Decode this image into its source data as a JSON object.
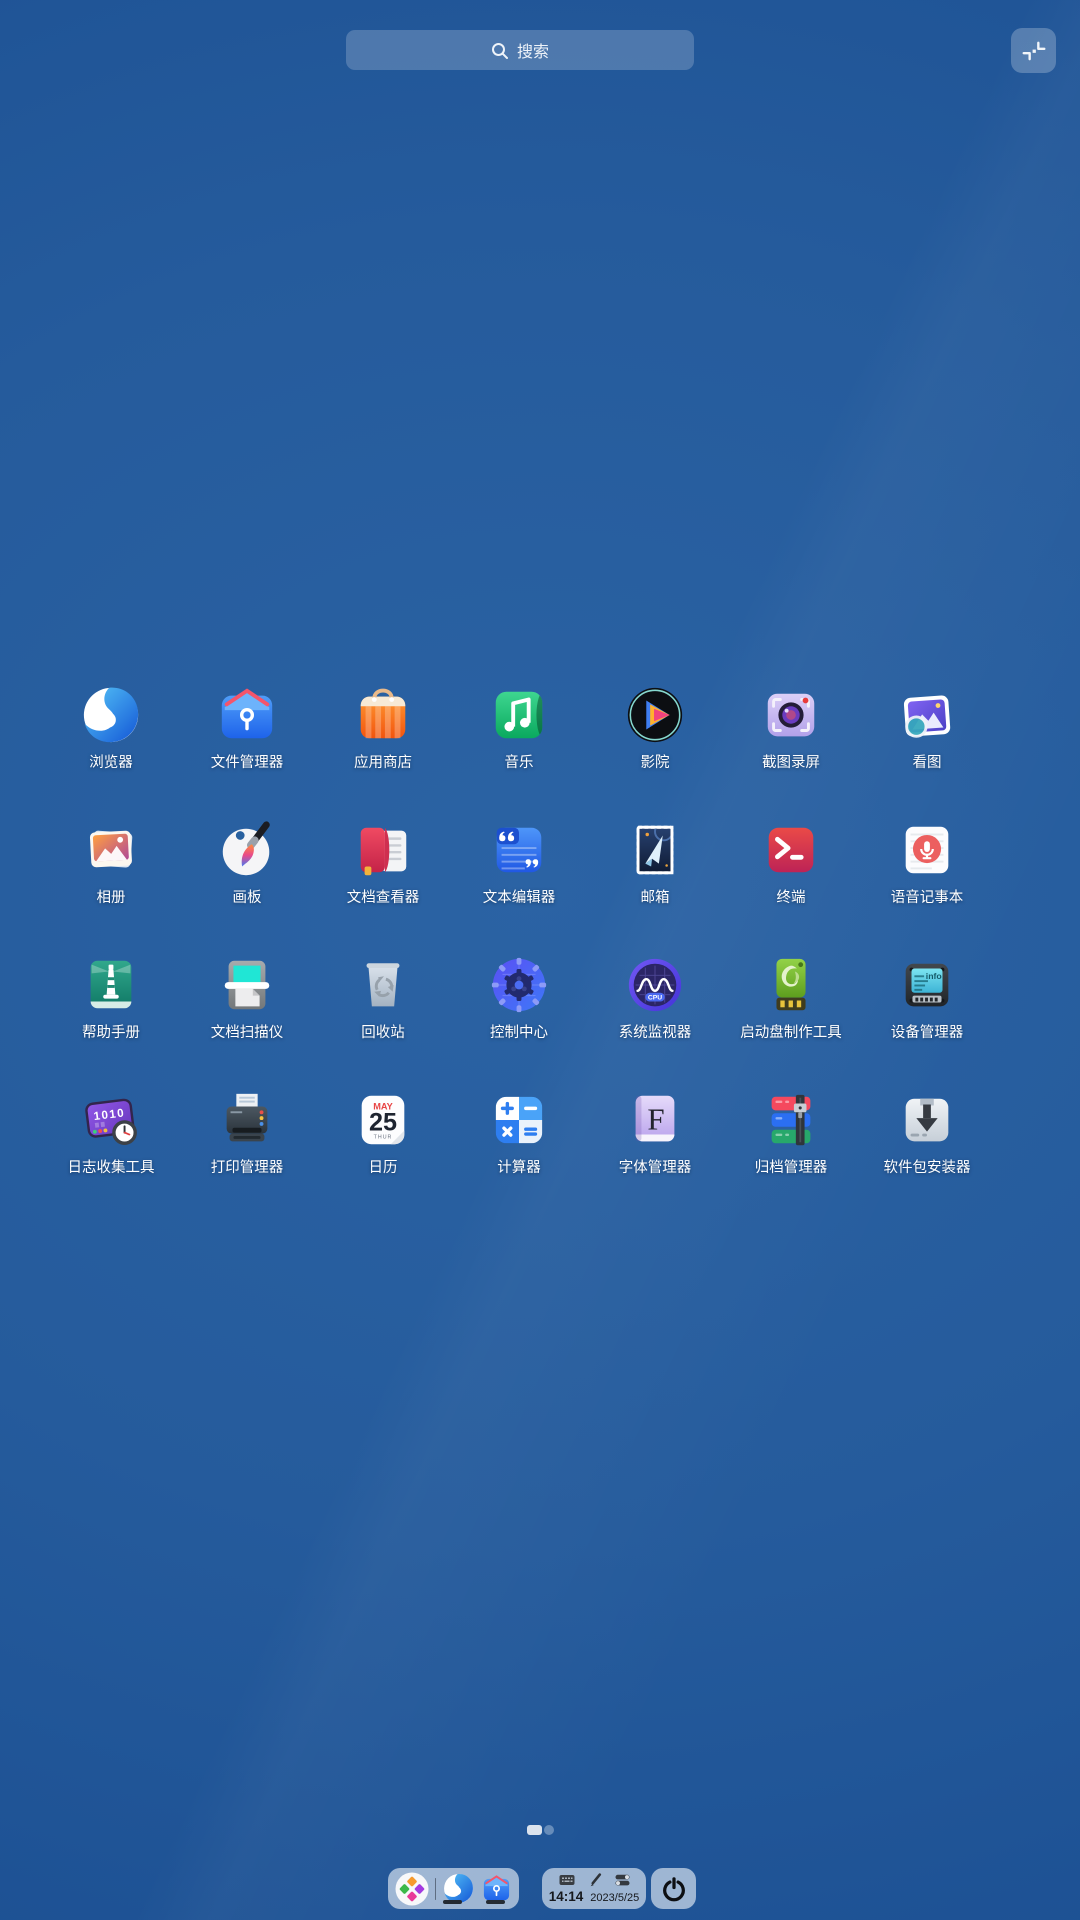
{
  "search": {
    "placeholder": "搜索"
  },
  "topbar": {
    "mode_toggle_icon": "exit-fullscreen-icon"
  },
  "apps": [
    {
      "label": "浏览器",
      "icon": "browser-icon"
    },
    {
      "label": "文件管理器",
      "icon": "file-manager-icon"
    },
    {
      "label": "应用商店",
      "icon": "app-store-icon"
    },
    {
      "label": "音乐",
      "icon": "music-icon"
    },
    {
      "label": "影院",
      "icon": "movie-icon"
    },
    {
      "label": "截图录屏",
      "icon": "screen-capture-icon"
    },
    {
      "label": "看图",
      "icon": "image-viewer-icon"
    },
    {
      "label": "相册",
      "icon": "album-icon"
    },
    {
      "label": "画板",
      "icon": "draw-icon"
    },
    {
      "label": "文档查看器",
      "icon": "document-viewer-icon"
    },
    {
      "label": "文本编辑器",
      "icon": "text-editor-icon"
    },
    {
      "label": "邮箱",
      "icon": "mail-icon"
    },
    {
      "label": "终端",
      "icon": "terminal-icon"
    },
    {
      "label": "语音记事本",
      "icon": "voice-notes-icon"
    },
    {
      "label": "帮助手册",
      "icon": "help-manual-icon"
    },
    {
      "label": "文档扫描仪",
      "icon": "document-scanner-icon"
    },
    {
      "label": "回收站",
      "icon": "trash-icon"
    },
    {
      "label": "控制中心",
      "icon": "control-center-icon"
    },
    {
      "label": "系统监视器",
      "icon": "system-monitor-icon",
      "icon_text": "CPU"
    },
    {
      "label": "启动盘制作工具",
      "icon": "boot-maker-icon"
    },
    {
      "label": "设备管理器",
      "icon": "device-manager-icon",
      "icon_text": "info"
    },
    {
      "label": "日志收集工具",
      "icon": "log-collector-icon",
      "icon_text": "1010"
    },
    {
      "label": "打印管理器",
      "icon": "print-manager-icon"
    },
    {
      "label": "日历",
      "icon": "calendar-icon",
      "icon_text": {
        "month": "MAY",
        "day": "25",
        "weekday": "THUR"
      }
    },
    {
      "label": "计算器",
      "icon": "calculator-icon"
    },
    {
      "label": "字体管理器",
      "icon": "font-manager-icon",
      "icon_text": "F"
    },
    {
      "label": "归档管理器",
      "icon": "archive-manager-icon"
    },
    {
      "label": "软件包安装器",
      "icon": "package-installer-icon"
    }
  ],
  "pager": {
    "total_pages": 2,
    "active_page": 1
  },
  "dock": {
    "items": [
      {
        "icon": "launcher-grid-icon",
        "running": false
      },
      {
        "icon": "browser-icon",
        "running": true
      },
      {
        "icon": "file-manager-icon",
        "running": true
      }
    ],
    "tray": {
      "icons": [
        "keyboard-icon",
        "input-pen-icon",
        "toggles-icon"
      ],
      "time": "14:14",
      "date": "2023/5/25"
    },
    "power_icon": "power-icon"
  },
  "colors": {
    "background_center": "#2b63a4",
    "background_edge": "#1c5093",
    "dock_bg": "rgba(218,229,240,0.68)",
    "label_text": "#ffffff",
    "tray_text": "#16191d"
  }
}
